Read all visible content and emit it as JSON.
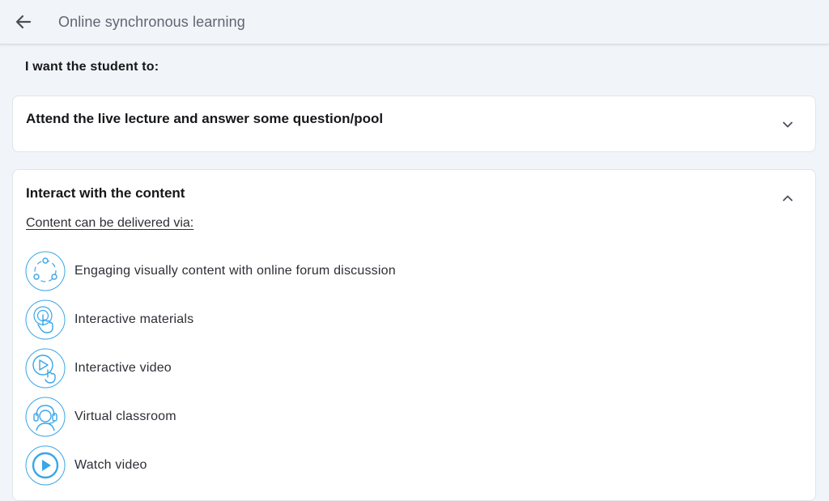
{
  "header": {
    "title": "Online synchronous learning",
    "back_icon": "arrow-left-icon"
  },
  "intro": {
    "heading": "I want the student to:"
  },
  "cards": [
    {
      "title": "Attend the live lecture and answer some question/pool",
      "state": "collapsed",
      "toggle_icon": "chevron-down-icon"
    },
    {
      "title": "Interact with the content",
      "state": "expanded",
      "toggle_icon": "chevron-up-icon",
      "subtitle": "Content can be delivered via:",
      "options": [
        {
          "label": "Engaging visually content with online forum discussion",
          "icon": "share-network-icon"
        },
        {
          "label": "Interactive materials",
          "icon": "touch-hand-icon"
        },
        {
          "label": "Interactive video",
          "icon": "play-touch-icon"
        },
        {
          "label": "Virtual classroom",
          "icon": "headset-person-icon"
        },
        {
          "label": "Watch video",
          "icon": "play-circle-icon"
        }
      ]
    }
  ],
  "colors": {
    "background": "#f1f4f9",
    "card": "#ffffff",
    "icon_accent": "#3aa6e8",
    "title_muted": "#5f6672"
  }
}
